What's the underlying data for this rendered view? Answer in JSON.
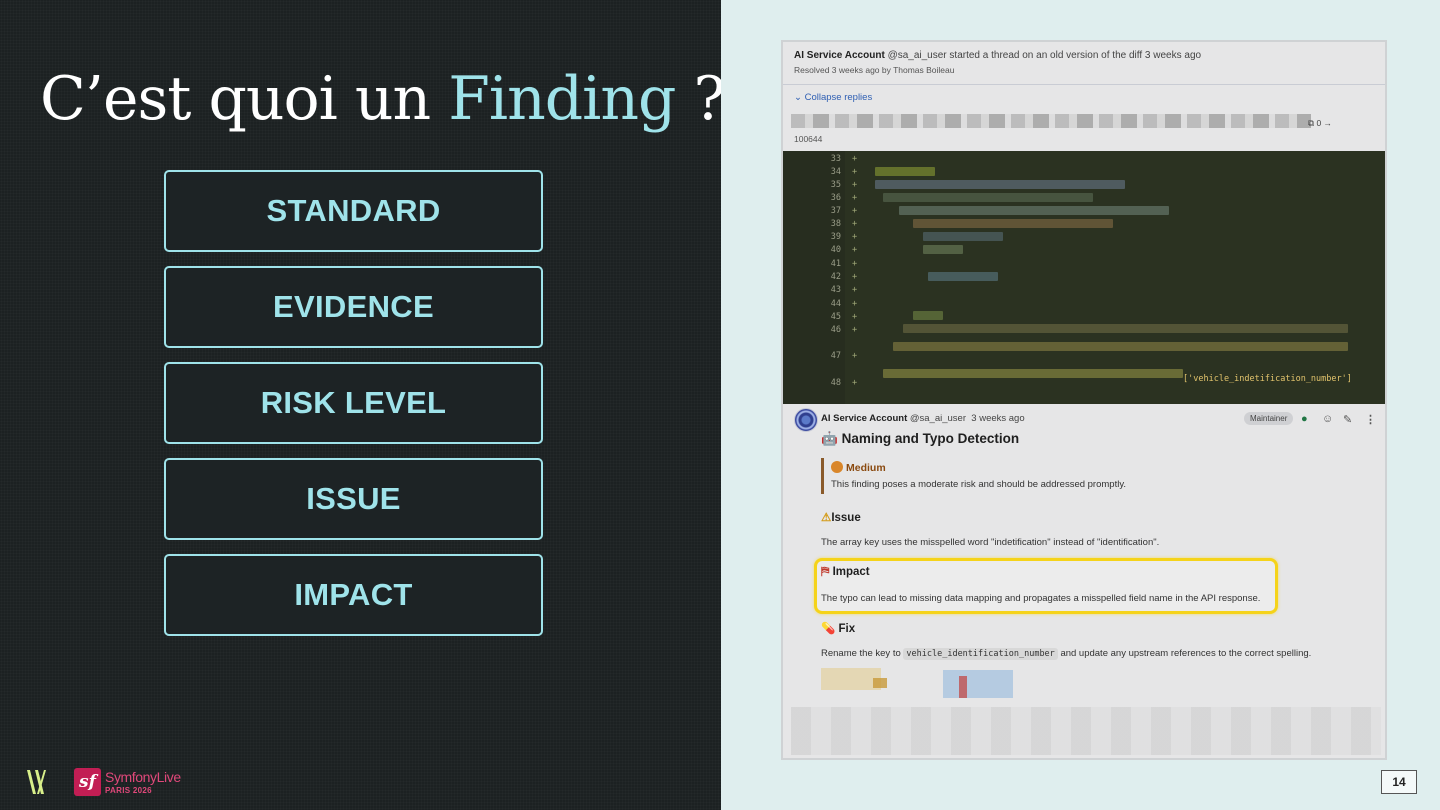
{
  "slide": {
    "title_prefix": "C’est quoi un ",
    "title_accent": "Finding",
    "title_suffix": " ?",
    "boxes": [
      "STANDARD",
      "EVIDENCE",
      "RISK LEVEL",
      "ISSUE",
      "IMPACT"
    ],
    "page_number": "14",
    "brand": {
      "name": "SymfonyLive",
      "city": "PARIS 2026",
      "badge": "sf"
    },
    "accent_color": "#9fe3ea"
  },
  "thread": {
    "author": "AI Service Account",
    "handle": "@sa_ai_user",
    "header_action": "started a thread on an old version of the diff 3 weeks ago",
    "resolved": "Resolved 3 weeks ago by Thomas Boileau",
    "collapse_label": "Collapse replies",
    "file_meta": "0 →",
    "file_number": "100644"
  },
  "code": {
    "line_numbers": [
      "33",
      "34",
      "35",
      "36",
      "37",
      "38",
      "39",
      "40",
      "41",
      "42",
      "43",
      "44",
      "45",
      "46",
      "47",
      "48"
    ],
    "tail_text": "['vehicle_indetification_number']"
  },
  "comment": {
    "author": "AI Service Account",
    "handle": "@sa_ai_user",
    "time": "3 weeks ago",
    "role_badge": "Maintainer",
    "heading": "Naming and Typo Detection",
    "heading_emoji": "🤖",
    "risk_level": "Medium",
    "risk_desc": "This finding poses a moderate risk and should be addressed promptly.",
    "issue_title": "Issue",
    "issue_emoji": "⚠",
    "issue_text": "The array key uses the misspelled word \"indetification\" instead of \"identification\".",
    "impact_title": "Impact",
    "impact_emoji": "⛿",
    "impact_text": "The typo can lead to missing data mapping and propagates a misspelled field name in the API response.",
    "fix_title": "Fix",
    "fix_emoji": "💊",
    "fix_pre": "Rename the key to",
    "fix_code": "vehicle_identification_number",
    "fix_post": "and update any upstream references to the correct spelling."
  }
}
